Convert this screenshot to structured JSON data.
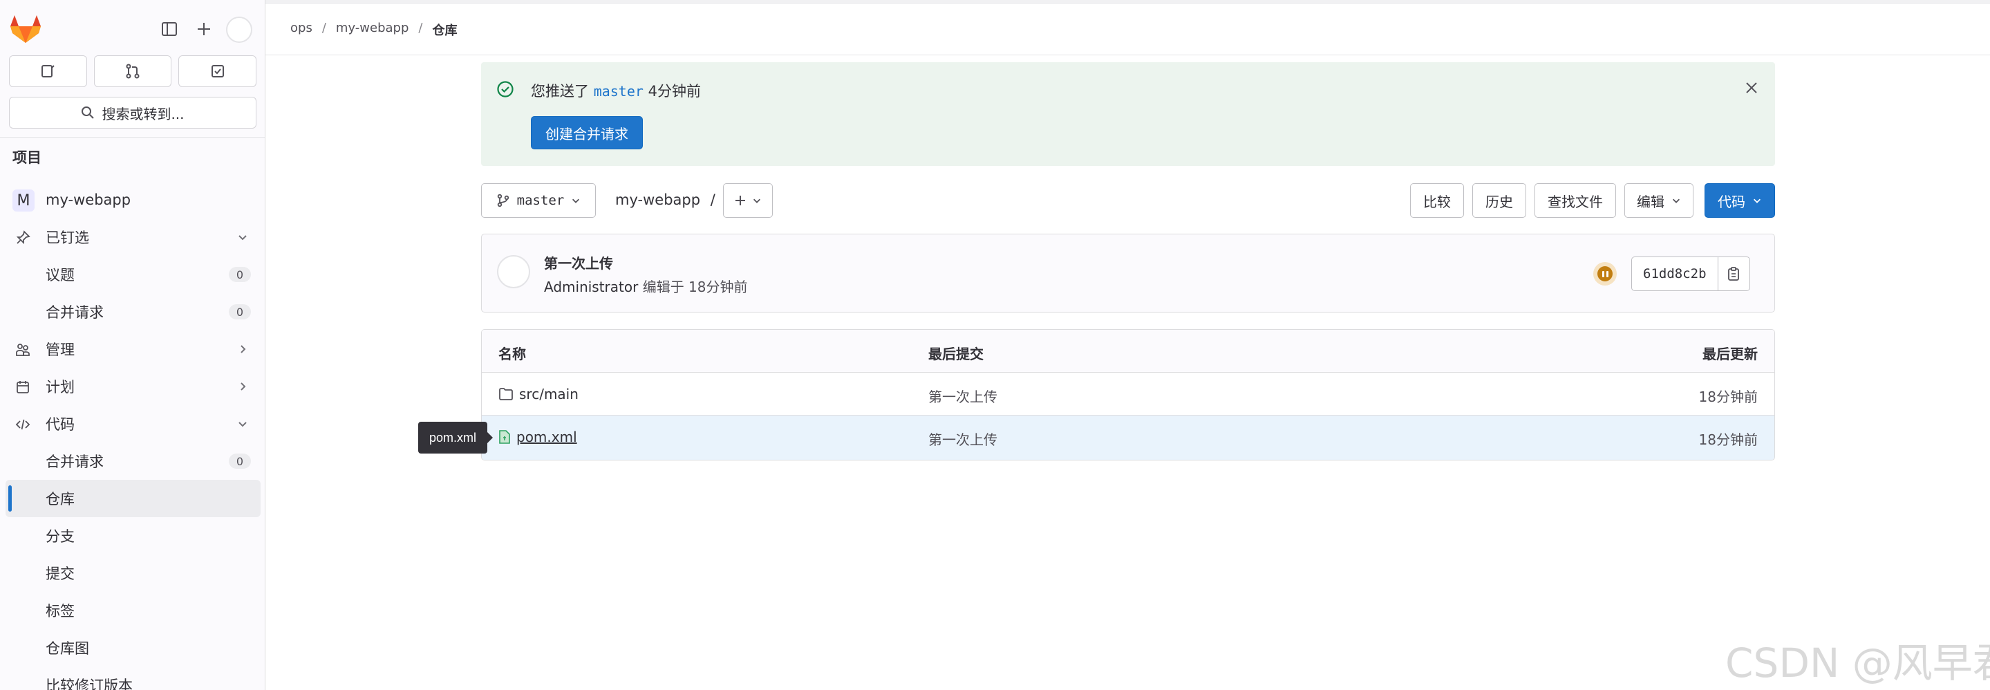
{
  "sidebar": {
    "search_placeholder": "搜索或转到...",
    "section_title": "项目",
    "project_initial": "M",
    "project_name": "my-webapp",
    "items": [
      {
        "label": "已钉选"
      },
      {
        "label": "议题",
        "count": "0"
      },
      {
        "label": "合并请求",
        "count": "0"
      },
      {
        "label": "管理"
      },
      {
        "label": "计划"
      },
      {
        "label": "代码"
      },
      {
        "label": "合并请求",
        "count": "0"
      },
      {
        "label": "仓库"
      },
      {
        "label": "分支"
      },
      {
        "label": "提交"
      },
      {
        "label": "标签"
      },
      {
        "label": "仓库图"
      },
      {
        "label": "比较修订版本"
      }
    ]
  },
  "breadcrumb": [
    "ops",
    "/",
    "my-webapp",
    "/",
    "仓库"
  ],
  "alert": {
    "text_prefix": "您推送了",
    "branch": "master",
    "text_suffix": "4分钟前",
    "button": "创建合并请求"
  },
  "toolbar": {
    "branch": "master",
    "path": "my-webapp",
    "path_sep": "/",
    "compare": "比较",
    "history": "历史",
    "find_file": "查找文件",
    "edit": "编辑",
    "code": "代码"
  },
  "commit": {
    "title": "第一次上传",
    "author": "Administrator",
    "meta": "编辑于 18分钟前",
    "sha": "61dd8c2b"
  },
  "table": {
    "headers": [
      "名称",
      "最后提交",
      "最后更新"
    ],
    "rows": [
      {
        "name": "src/main",
        "commit": "第一次上传",
        "updated": "18分钟前"
      },
      {
        "name": "pom.xml",
        "commit": "第一次上传",
        "updated": "18分钟前"
      }
    ]
  },
  "tooltip": "pom.xml",
  "watermark": "CSDN @风早君",
  "colors": {
    "primary": "#1f75cb",
    "success_bg": "#ecf4ee",
    "success": "#108548",
    "pipeline": "#c17d10"
  }
}
